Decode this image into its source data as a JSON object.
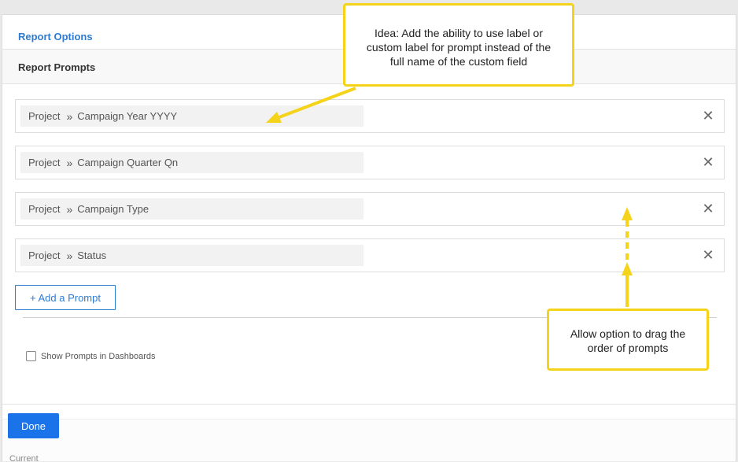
{
  "header": {
    "link_label": "Report Options"
  },
  "section": {
    "title": "Report Prompts"
  },
  "prompts": [
    {
      "prefix": "Project",
      "separator": "»",
      "field": "Campaign Year YYYY",
      "remove": "✕"
    },
    {
      "prefix": "Project",
      "separator": "»",
      "field": "Campaign Quarter Qn",
      "remove": "✕"
    },
    {
      "prefix": "Project",
      "separator": "»",
      "field": "Campaign Type",
      "remove": "✕"
    },
    {
      "prefix": "Project",
      "separator": "»",
      "field": "Status",
      "remove": "✕"
    }
  ],
  "actions": {
    "add_prompt_label": "+ Add a Prompt",
    "done_label": "Done"
  },
  "options": {
    "show_in_dashboards_label": "Show Prompts in Dashboards",
    "show_in_dashboards_checked": false
  },
  "annotations": {
    "idea_lines": [
      "Idea:  Add the ability to use label or",
      "custom label for prompt instead of the",
      "full name of the custom field"
    ],
    "drag_lines": [
      "Allow option to drag the",
      "order of prompts"
    ],
    "color": "#f5d31a"
  },
  "background_peek": "Current"
}
